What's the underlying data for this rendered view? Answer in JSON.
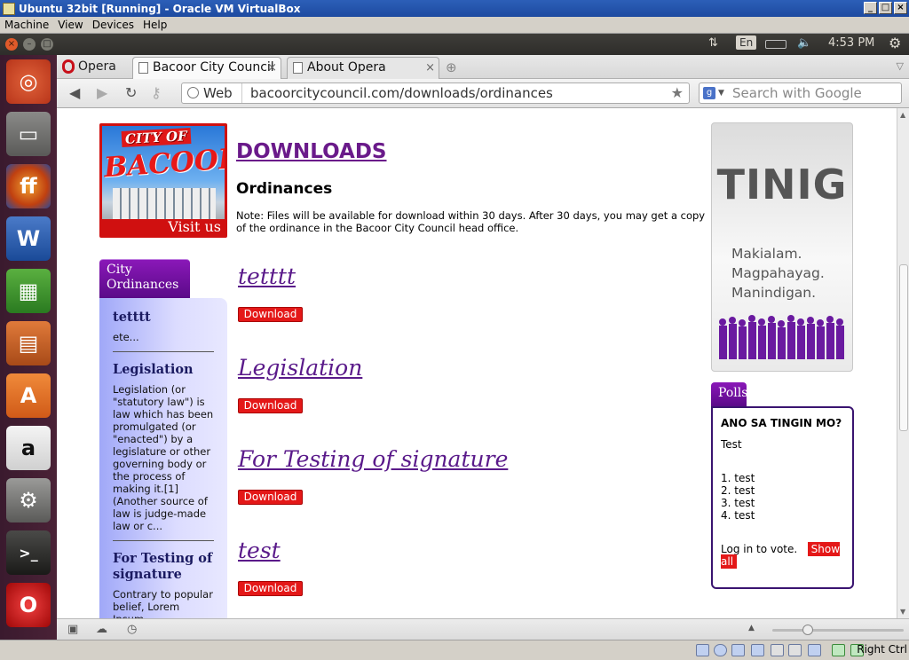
{
  "vm": {
    "title": "Ubuntu 32bit [Running] - Oracle VM VirtualBox",
    "menu": [
      "Machine",
      "View",
      "Devices",
      "Help"
    ],
    "host_key": "Right Ctrl"
  },
  "ubuntu_panel": {
    "language": "En",
    "clock": "4:53 PM"
  },
  "launcher": [
    "ubuntu-dash-icon",
    "files-icon",
    "firefox-icon",
    "writer-icon",
    "calc-icon",
    "impress-icon",
    "software-center-icon",
    "amazon-icon",
    "settings-icon",
    "terminal-icon",
    "opera-icon"
  ],
  "browser": {
    "menu_button": "Opera",
    "tabs": [
      {
        "title": "Bacoor City Council",
        "active": true
      },
      {
        "title": "About Opera",
        "active": false
      }
    ],
    "address": {
      "badge": "Web",
      "url": "bacoorcitycouncil.com/downloads/ordinances"
    },
    "search_placeholder": "Search with Google"
  },
  "page": {
    "logo": {
      "line1": "CITY OF",
      "line2": "BACOOR",
      "visit": "Visit us"
    },
    "heading": "DOWNLOADS",
    "subheading": "Ordinances",
    "note": "Note: Files will be available for download within 30 days. After 30 days, you may get a copy of the ordinance in the Bacoor City Council head office.",
    "sidebar": {
      "tab_label": "City Ordinances",
      "items": [
        {
          "title": "tetttt",
          "excerpt": "ete..."
        },
        {
          "title": "Legislation",
          "excerpt": "Legislation (or \"statutory law\") is law which has been promulgated (or \"enacted\") by a legislature or other governing body or the process of making it.[1] (Another source of law is judge-made law or c..."
        },
        {
          "title": "For Testing of signature",
          "excerpt": "Contrary to popular belief, Lorem Ipsum"
        }
      ]
    },
    "entries": [
      {
        "title": "tetttt",
        "button": "Download"
      },
      {
        "title": "Legislation",
        "button": "Download"
      },
      {
        "title": "For Testing of signature",
        "button": "Download"
      },
      {
        "title": "test",
        "button": "Download"
      }
    ],
    "banner": {
      "title": "TINIG",
      "lines": [
        "Makialam.",
        "Magpahayag.",
        "Manindigan."
      ]
    },
    "polls": {
      "tab_label": "Polls",
      "question": "ANO SA TINGIN MO?",
      "description": "Test",
      "options": [
        "1. test",
        "2. test",
        "3. test",
        "4. test"
      ],
      "login_text": "Log in to vote.",
      "show_all": "Show all"
    }
  }
}
